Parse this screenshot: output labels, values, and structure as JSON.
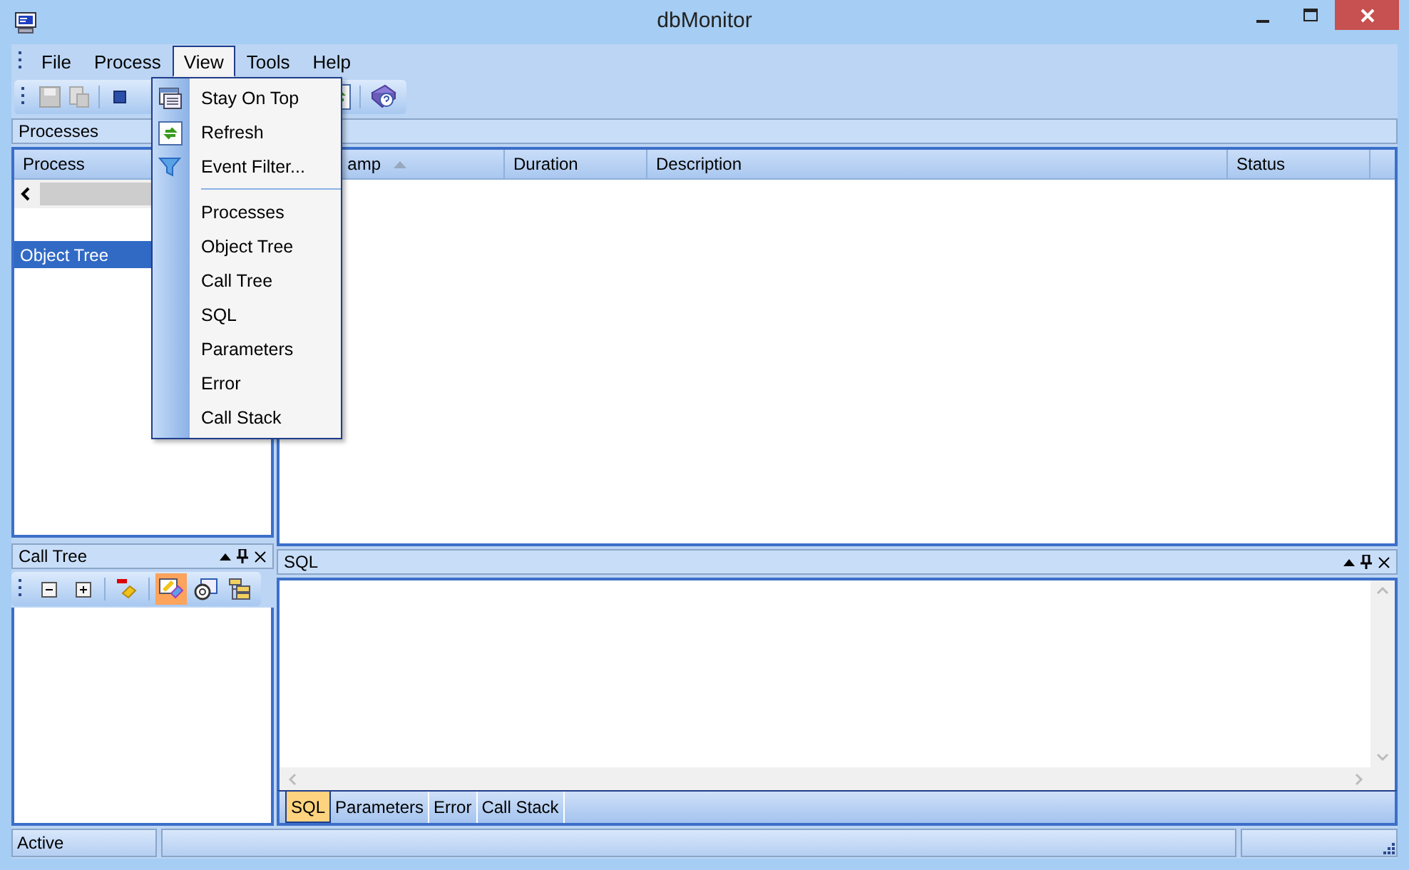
{
  "window": {
    "title": "dbMonitor"
  },
  "menu_bar": [
    {
      "label": "File",
      "selected": false
    },
    {
      "label": "Process",
      "selected": false
    },
    {
      "label": "View",
      "selected": true
    },
    {
      "label": "Tools",
      "selected": false
    },
    {
      "label": "Help",
      "selected": false
    }
  ],
  "view_menu": [
    {
      "kind": "item",
      "label": "Stay On Top"
    },
    {
      "kind": "item",
      "label": "Refresh"
    },
    {
      "kind": "item",
      "label": "Event Filter..."
    },
    {
      "kind": "separator"
    },
    {
      "kind": "item",
      "label": "Processes"
    },
    {
      "kind": "item",
      "label": "Object Tree"
    },
    {
      "kind": "item",
      "label": "Call Tree"
    },
    {
      "kind": "item",
      "label": "SQL"
    },
    {
      "kind": "item",
      "label": "Parameters"
    },
    {
      "kind": "item",
      "label": "Error"
    },
    {
      "kind": "item",
      "label": "Call Stack"
    }
  ],
  "processes_pane": {
    "title": "Processes",
    "columns": [
      "Process"
    ]
  },
  "object_tree_pane": {
    "title": "Object Tree",
    "active": true
  },
  "call_tree_pane": {
    "title": "Call Tree",
    "toolbar": [
      {
        "selected": false
      },
      {
        "selected": false
      },
      {
        "selected": false
      },
      {
        "selected": true
      },
      {
        "selected": false
      },
      {
        "selected": false
      }
    ]
  },
  "event_list": {
    "columns": [
      "amp",
      "Duration",
      "Description",
      "Status"
    ]
  },
  "sql_pane": {
    "title": "SQL",
    "tabs": [
      {
        "label": "SQL",
        "selected": true
      },
      {
        "label": "Parameters",
        "selected": false
      },
      {
        "label": "Error",
        "selected": false
      },
      {
        "label": "Call Stack",
        "selected": false
      }
    ]
  },
  "status_bar": [
    "Active"
  ]
}
